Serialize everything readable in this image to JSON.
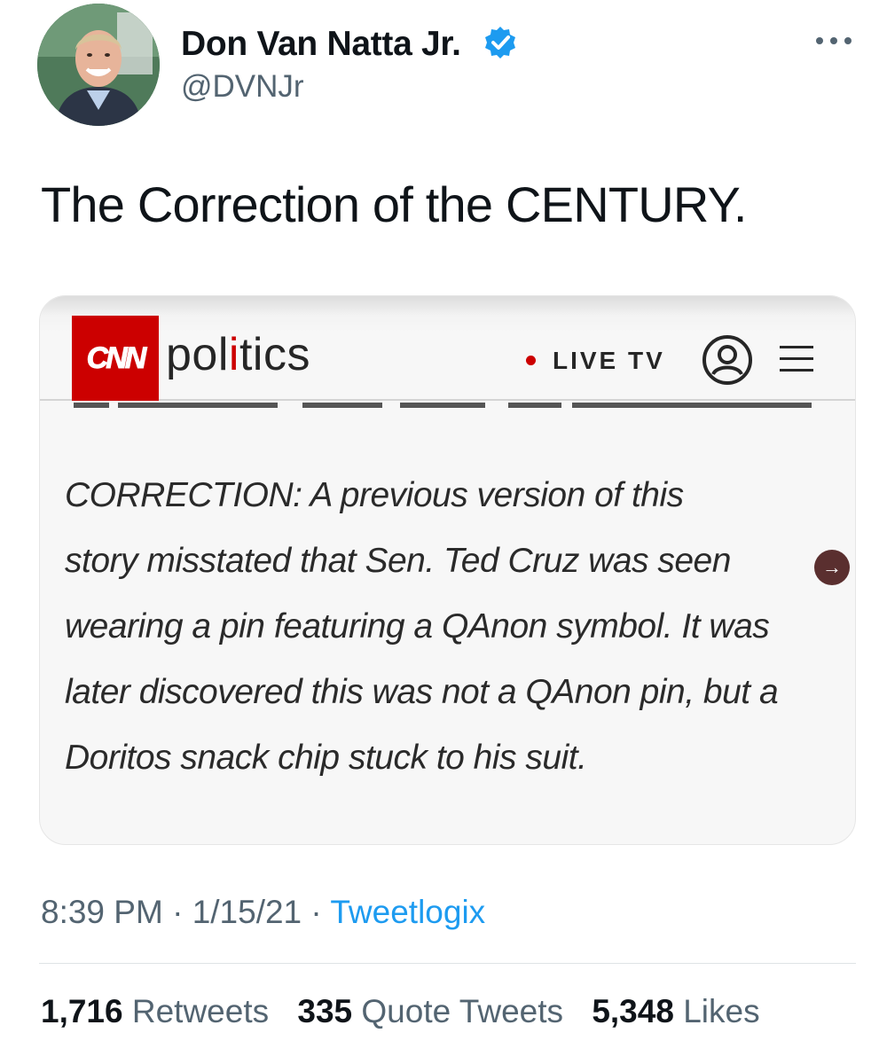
{
  "author": {
    "display_name": "Don Van Natta Jr.",
    "handle": "@DVNJr",
    "avatar_icon": "profile-photo",
    "verified_icon": "verified-badge-icon",
    "verified_color": "#1d9bf0"
  },
  "tweet": {
    "text": "The Correction of the CENTURY."
  },
  "media": {
    "logo_text": "CNN",
    "logo_color": "#cc0000",
    "section_label_part1": "pol",
    "section_label_i": "i",
    "section_label_part2": "tics",
    "live_label": "LIVE TV",
    "correction_lines": [
      "CORRECTION: A previous version of this",
      "story misstated that Sen. Ted Cruz was seen",
      "wearing a pin featuring a QAnon symbol. It was",
      "later discovered this was not a QAnon pin, but a",
      "Doritos snack chip stuck to his suit."
    ],
    "arrow_glyph": "→"
  },
  "meta": {
    "time": "8:39 PM",
    "separator": " · ",
    "date": "1/15/21",
    "source": "Tweetlogix"
  },
  "stats": {
    "retweets_count": "1,716",
    "retweets_label": "Retweets",
    "quotes_count": "335",
    "quotes_label": "Quote Tweets",
    "likes_count": "5,348",
    "likes_label": "Likes"
  }
}
